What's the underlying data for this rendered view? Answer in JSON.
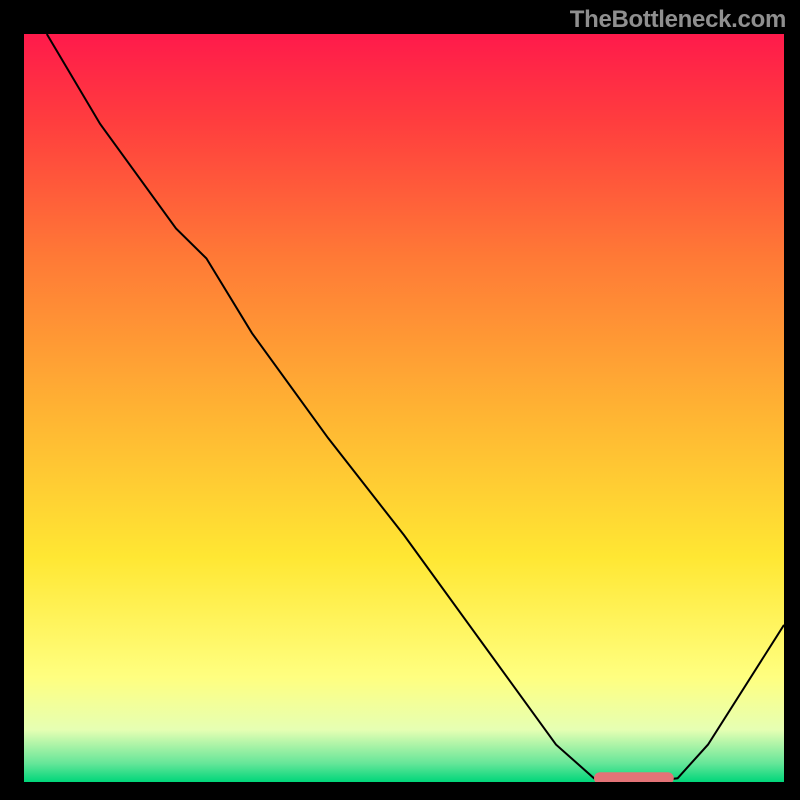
{
  "watermark": "TheBottleneck.com",
  "chart_data": {
    "type": "line",
    "title": "",
    "xlabel": "",
    "ylabel": "",
    "xlim": [
      0,
      100
    ],
    "ylim": [
      0,
      100
    ],
    "grid": false,
    "background_gradient": {
      "direction": "vertical",
      "stops": [
        {
          "offset": 0.0,
          "color": "#ff1a4b"
        },
        {
          "offset": 0.12,
          "color": "#ff3e3e"
        },
        {
          "offset": 0.3,
          "color": "#ff7a36"
        },
        {
          "offset": 0.5,
          "color": "#ffb233"
        },
        {
          "offset": 0.7,
          "color": "#ffe733"
        },
        {
          "offset": 0.86,
          "color": "#ffff80"
        },
        {
          "offset": 0.93,
          "color": "#e6ffb3"
        },
        {
          "offset": 0.975,
          "color": "#66e699"
        },
        {
          "offset": 1.0,
          "color": "#00d67a"
        }
      ]
    },
    "series": [
      {
        "name": "bottleneck-curve",
        "color": "#000000",
        "stroke_width": 2,
        "x": [
          3.0,
          10.0,
          20.0,
          24.0,
          30.0,
          40.0,
          50.0,
          60.0,
          70.0,
          75.0,
          78.0,
          82.0,
          86.0,
          90.0,
          100.0
        ],
        "y": [
          100.0,
          88.0,
          74.0,
          70.0,
          60.0,
          46.0,
          33.0,
          19.0,
          5.0,
          0.5,
          0.0,
          0.0,
          0.5,
          5.0,
          21.0
        ]
      }
    ],
    "markers": [
      {
        "name": "optimal-range-bar",
        "shape": "rounded-rect",
        "color": "#e37377",
        "x_start": 75.0,
        "x_end": 85.5,
        "y": 0.5,
        "thickness_pct": 1.6
      }
    ]
  }
}
